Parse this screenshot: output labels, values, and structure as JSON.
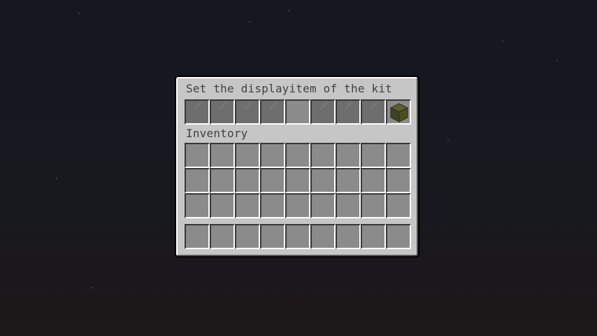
{
  "window": {
    "title": "Set the displayitem of the kit",
    "inventory_label": "Inventory"
  },
  "kit_slots": [
    {
      "item": "gray-glass-pane"
    },
    {
      "item": "gray-glass-pane"
    },
    {
      "item": "gray-glass-pane"
    },
    {
      "item": "gray-glass-pane"
    },
    {
      "item": "empty"
    },
    {
      "item": "gray-glass-pane"
    },
    {
      "item": "gray-glass-pane"
    },
    {
      "item": "gray-glass-pane"
    },
    {
      "item": "dark-green-block"
    }
  ],
  "inventory": {
    "rows": 3,
    "columns": 9,
    "hotbar_slots": 9
  },
  "colors": {
    "panel": "#c6c6c6",
    "slot": "#8b8b8b",
    "pane": "#6e6e6e",
    "block_top": "#5b5f2e",
    "block_side": "#3f4220",
    "text": "#404040"
  }
}
